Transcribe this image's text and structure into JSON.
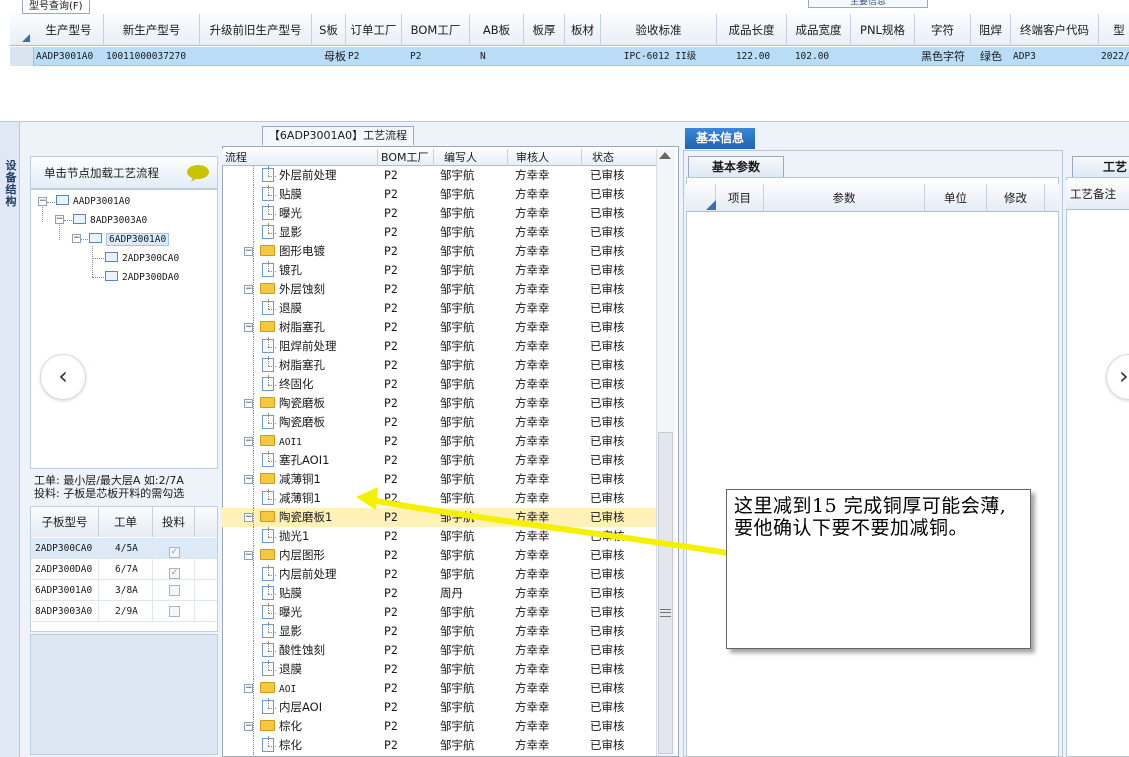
{
  "top": {
    "query_tab": "型号查询(F)",
    "main_info_tab": "主要信息",
    "columns": [
      "生产型号",
      "新生产型号",
      "升级前旧生产型号",
      "S板",
      "订单工厂",
      "BOM工厂",
      "AB板",
      "板厚",
      "板材",
      "验收标准",
      "成品长度",
      "成品宽度",
      "PNL规格",
      "字符",
      "阻焊",
      "终端客户代码",
      "型"
    ],
    "row": [
      "AADP3001A0",
      "10011000037270",
      "",
      "母板",
      "P2",
      "P2",
      "N",
      "",
      "",
      "IPC-6012 II级",
      "122.00",
      "102.00",
      "",
      "黑色字符",
      "绿色",
      "ADP3",
      "2022/"
    ]
  },
  "left": {
    "vertical_tab": "设备结构",
    "node_header": "单击节点加载工艺流程",
    "tree": [
      "AADP3001A0",
      "8ADP3003A0",
      "6ADP3001A0",
      "2ADP300CA0",
      "2ADP300DA0"
    ],
    "info_line1": "工单: 最小层/最大层A 如:2/7A",
    "info_line2": "投料: 子板是芯板开料的需勾选",
    "sub_columns": [
      "子板型号",
      "工单",
      "投料"
    ],
    "sub_rows": [
      {
        "model": "2ADP300CA0",
        "order": "4/5A",
        "checked": true
      },
      {
        "model": "2ADP300DA0",
        "order": "6/7A",
        "checked": true
      },
      {
        "model": "6ADP3001A0",
        "order": "3/8A",
        "checked": false
      },
      {
        "model": "8ADP3003A0",
        "order": "2/9A",
        "checked": false
      }
    ],
    "nav_prev": "‹"
  },
  "flow": {
    "title": "【6ADP3001A0】工艺流程",
    "columns": [
      "流程",
      "BOM工厂",
      "编写人",
      "审核人",
      "状态"
    ],
    "rows": [
      {
        "type": "doc",
        "name": "外层前处理",
        "bom": "P2",
        "writer": "邹宇航",
        "reviewer": "方幸幸",
        "status": "已审核"
      },
      {
        "type": "doc",
        "name": "贴膜",
        "bom": "P2",
        "writer": "邹宇航",
        "reviewer": "方幸幸",
        "status": "已审核"
      },
      {
        "type": "doc",
        "name": "曝光",
        "bom": "P2",
        "writer": "邹宇航",
        "reviewer": "方幸幸",
        "status": "已审核"
      },
      {
        "type": "doc",
        "name": "显影",
        "bom": "P2",
        "writer": "邹宇航",
        "reviewer": "方幸幸",
        "status": "已审核"
      },
      {
        "type": "folder",
        "name": "图形电镀",
        "bom": "P2",
        "writer": "邹宇航",
        "reviewer": "方幸幸",
        "status": "已审核"
      },
      {
        "type": "doc",
        "name": "镀孔",
        "bom": "P2",
        "writer": "邹宇航",
        "reviewer": "方幸幸",
        "status": "已审核"
      },
      {
        "type": "folder",
        "name": "外层蚀刻",
        "bom": "P2",
        "writer": "邹宇航",
        "reviewer": "方幸幸",
        "status": "已审核"
      },
      {
        "type": "doc",
        "name": "退膜",
        "bom": "P2",
        "writer": "邹宇航",
        "reviewer": "方幸幸",
        "status": "已审核"
      },
      {
        "type": "folder",
        "name": "树脂塞孔",
        "bom": "P2",
        "writer": "邹宇航",
        "reviewer": "方幸幸",
        "status": "已审核"
      },
      {
        "type": "doc",
        "name": "阻焊前处理",
        "bom": "P2",
        "writer": "邹宇航",
        "reviewer": "方幸幸",
        "status": "已审核"
      },
      {
        "type": "doc",
        "name": "树脂塞孔",
        "bom": "P2",
        "writer": "邹宇航",
        "reviewer": "方幸幸",
        "status": "已审核"
      },
      {
        "type": "doc",
        "name": "终固化",
        "bom": "P2",
        "writer": "邹宇航",
        "reviewer": "方幸幸",
        "status": "已审核"
      },
      {
        "type": "folder",
        "name": "陶瓷磨板",
        "bom": "P2",
        "writer": "邹宇航",
        "reviewer": "方幸幸",
        "status": "已审核"
      },
      {
        "type": "doc",
        "name": "陶瓷磨板",
        "bom": "P2",
        "writer": "邹宇航",
        "reviewer": "方幸幸",
        "status": "已审核"
      },
      {
        "type": "folder",
        "name": "AOI1",
        "bom": "P2",
        "writer": "邹宇航",
        "reviewer": "方幸幸",
        "status": "已审核"
      },
      {
        "type": "doc",
        "name": "塞孔AOI1",
        "bom": "P2",
        "writer": "邹宇航",
        "reviewer": "方幸幸",
        "status": "已审核"
      },
      {
        "type": "folder",
        "name": "减薄铜1",
        "bom": "P2",
        "writer": "邹宇航",
        "reviewer": "方幸幸",
        "status": "已审核"
      },
      {
        "type": "doc",
        "name": "减薄铜1",
        "bom": "P2",
        "writer": "邹宇航",
        "reviewer": "方幸幸",
        "status": "已审核"
      },
      {
        "type": "folder",
        "name": "陶瓷磨板1",
        "bom": "P2",
        "writer": "邹宇航",
        "reviewer": "方幸幸",
        "status": "已审核",
        "highlight": true
      },
      {
        "type": "doc",
        "name": "抛光1",
        "bom": "P2",
        "writer": "邹宇航",
        "reviewer": "方幸幸",
        "status": "已审核"
      },
      {
        "type": "folder",
        "name": "内层图形",
        "bom": "P2",
        "writer": "邹宇航",
        "reviewer": "方幸幸",
        "status": "已审核"
      },
      {
        "type": "doc",
        "name": "内层前处理",
        "bom": "P2",
        "writer": "邹宇航",
        "reviewer": "方幸幸",
        "status": "已审核"
      },
      {
        "type": "doc",
        "name": "贴膜",
        "bom": "P2",
        "writer": "周丹",
        "reviewer": "方幸幸",
        "status": "已审核"
      },
      {
        "type": "doc",
        "name": "曝光",
        "bom": "P2",
        "writer": "邹宇航",
        "reviewer": "方幸幸",
        "status": "已审核"
      },
      {
        "type": "doc",
        "name": "显影",
        "bom": "P2",
        "writer": "邹宇航",
        "reviewer": "方幸幸",
        "status": "已审核"
      },
      {
        "type": "doc",
        "name": "酸性蚀刻",
        "bom": "P2",
        "writer": "邹宇航",
        "reviewer": "方幸幸",
        "status": "已审核"
      },
      {
        "type": "doc",
        "name": "退膜",
        "bom": "P2",
        "writer": "邹宇航",
        "reviewer": "方幸幸",
        "status": "已审核"
      },
      {
        "type": "folder",
        "name": "AOI",
        "bom": "P2",
        "writer": "邹宇航",
        "reviewer": "方幸幸",
        "status": "已审核"
      },
      {
        "type": "doc",
        "name": "内层AOI",
        "bom": "P2",
        "writer": "邹宇航",
        "reviewer": "方幸幸",
        "status": "已审核"
      },
      {
        "type": "folder",
        "name": "棕化",
        "bom": "P2",
        "writer": "邹宇航",
        "reviewer": "方幸幸",
        "status": "已审核"
      },
      {
        "type": "doc",
        "name": "棕化",
        "bom": "P2",
        "writer": "邹宇航",
        "reviewer": "方幸幸",
        "status": "已审核"
      }
    ]
  },
  "right": {
    "basic_info_tab": "基本信息",
    "params_tab": "基本参数",
    "params_columns": [
      "项目",
      "参数",
      "单位",
      "修改"
    ],
    "craft_tab": "工艺",
    "craft_note_header": "工艺备注",
    "nav_next": "›"
  },
  "annotation": {
    "text": "这里减到15 完成铜厚可能会薄, 要他确认下要不要加减铜。",
    "arrow_color": "#f5f000"
  },
  "colors": {
    "row_selected": "#b9dcf7",
    "row_highlight": "#fff1b8",
    "tab_active": "#1f63b5"
  }
}
